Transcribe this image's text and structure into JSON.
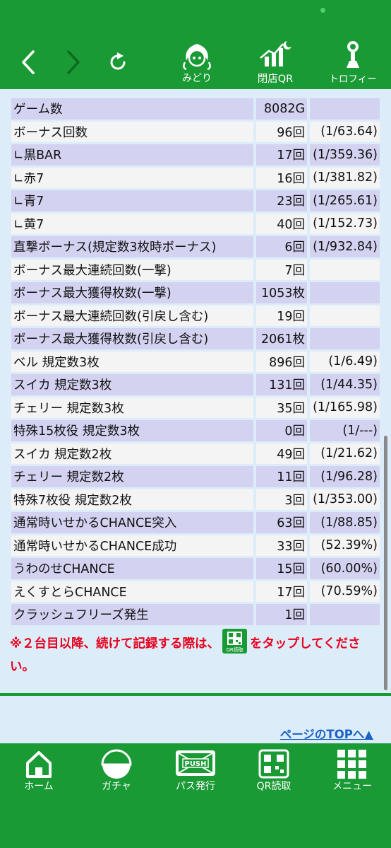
{
  "header": {
    "back_label": "<",
    "forward_label": ">",
    "items": [
      {
        "label": "みどり"
      },
      {
        "label": "閉店QR"
      },
      {
        "label": "トロフィー"
      }
    ]
  },
  "stats": [
    {
      "name": "ゲーム数",
      "count": "8082G",
      "rate": ""
    },
    {
      "name": "ボーナス回数",
      "count": "96回",
      "rate": "(1/63.64)"
    },
    {
      "name": "∟黒BAR",
      "count": "17回",
      "rate": "(1/359.36)"
    },
    {
      "name": "∟赤7",
      "count": "16回",
      "rate": "(1/381.82)"
    },
    {
      "name": "∟青7",
      "count": "23回",
      "rate": "(1/265.61)"
    },
    {
      "name": "∟黄7",
      "count": "40回",
      "rate": "(1/152.73)"
    },
    {
      "name": "直撃ボーナス(規定数3枚時ボーナス)",
      "count": "6回",
      "rate": "(1/932.84)"
    },
    {
      "name": "ボーナス最大連続回数(一撃)",
      "count": "7回",
      "rate": ""
    },
    {
      "name": "ボーナス最大獲得枚数(一撃)",
      "count": "1053枚",
      "rate": ""
    },
    {
      "name": "ボーナス最大連続回数(引戻し含む)",
      "count": "19回",
      "rate": ""
    },
    {
      "name": "ボーナス最大獲得枚数(引戻し含む)",
      "count": "2061枚",
      "rate": ""
    },
    {
      "name": "ベル 規定数3枚",
      "count": "896回",
      "rate": "(1/6.49)"
    },
    {
      "name": "スイカ 規定数3枚",
      "count": "131回",
      "rate": "(1/44.35)"
    },
    {
      "name": "チェリー 規定数3枚",
      "count": "35回",
      "rate": "(1/165.98)"
    },
    {
      "name": "特殊15枚役 規定数3枚",
      "count": "0回",
      "rate": "(1/---)"
    },
    {
      "name": "スイカ 規定数2枚",
      "count": "49回",
      "rate": "(1/21.62)"
    },
    {
      "name": "チェリー 規定数2枚",
      "count": "11回",
      "rate": "(1/96.28)"
    },
    {
      "name": "特殊7枚役 規定数2枚",
      "count": "3回",
      "rate": "(1/353.00)"
    },
    {
      "name": "通常時いせかるCHANCE突入",
      "count": "63回",
      "rate": "(1/88.85)"
    },
    {
      "name": "通常時いせかるCHANCE成功",
      "count": "33回",
      "rate": "(52.39%)"
    },
    {
      "name": "うわのせCHANCE",
      "count": "15回",
      "rate": "(60.00%)"
    },
    {
      "name": "えくすとらCHANCE",
      "count": "17回",
      "rate": "(70.59%)"
    },
    {
      "name": "クラッシュフリーズ発生",
      "count": "1回",
      "rate": ""
    }
  ],
  "note": {
    "before": "※２台目以降、続けて記録する際は、",
    "icon_label": "QR読取",
    "after": "をタップしてください。"
  },
  "page_top_link": "ページのTOPへ▲",
  "bottom_nav": [
    {
      "label": "ホーム"
    },
    {
      "label": "ガチャ"
    },
    {
      "label": "パス発行"
    },
    {
      "label": "QR読取"
    },
    {
      "label": "メニュー"
    }
  ],
  "colors": {
    "brand_green": "#1a9a35",
    "row_shade": "#d3d2f1",
    "row_plain": "#f4f4f4",
    "note_red": "#e8001d",
    "link_blue": "#1a62c6"
  }
}
